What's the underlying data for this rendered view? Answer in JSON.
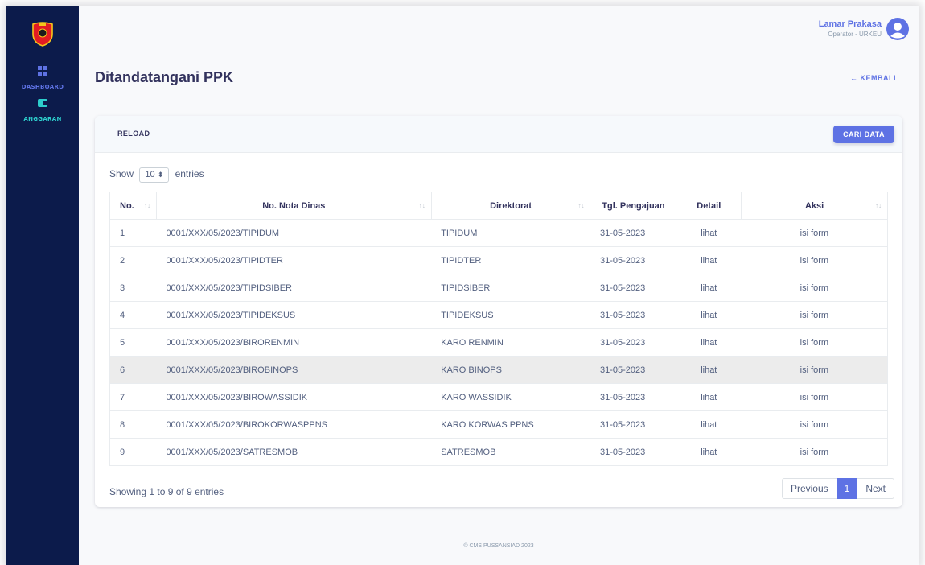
{
  "sidebar": {
    "items": [
      {
        "label": "DASHBOARD",
        "icon": "grid-icon",
        "color": "#5e72e4"
      },
      {
        "label": "ANGGARAN",
        "icon": "wallet-icon",
        "color": "#2dcecc"
      }
    ]
  },
  "user": {
    "name": "Lamar Prakasa",
    "role": "Operator - URKEU"
  },
  "page": {
    "title": "Ditandatangani PPK",
    "back_label": "← KEMBALI"
  },
  "card": {
    "reload_label": "RELOAD",
    "search_label": "CARI DATA"
  },
  "length_menu": {
    "prefix": "Show",
    "value": "10",
    "suffix": "entries"
  },
  "table": {
    "columns": [
      "No.",
      "No. Nota Dinas",
      "Direktorat",
      "Tgl. Pengajuan",
      "Detail",
      "Aksi"
    ],
    "rows": [
      {
        "no": "1",
        "nota": "0001/XXX/05/2023/TIPIDUM",
        "dir": "TIPIDUM",
        "tgl": "31-05-2023",
        "detail": "lihat",
        "aksi": "isi form"
      },
      {
        "no": "2",
        "nota": "0001/XXX/05/2023/TIPIDTER",
        "dir": "TIPIDTER",
        "tgl": "31-05-2023",
        "detail": "lihat",
        "aksi": "isi form"
      },
      {
        "no": "3",
        "nota": "0001/XXX/05/2023/TIPIDSIBER",
        "dir": "TIPIDSIBER",
        "tgl": "31-05-2023",
        "detail": "lihat",
        "aksi": "isi form"
      },
      {
        "no": "4",
        "nota": "0001/XXX/05/2023/TIPIDEKSUS",
        "dir": "TIPIDEKSUS",
        "tgl": "31-05-2023",
        "detail": "lihat",
        "aksi": "isi form"
      },
      {
        "no": "5",
        "nota": "0001/XXX/05/2023/BIRORENMIN",
        "dir": "KARO RENMIN",
        "tgl": "31-05-2023",
        "detail": "lihat",
        "aksi": "isi form"
      },
      {
        "no": "6",
        "nota": "0001/XXX/05/2023/BIROBINOPS",
        "dir": "KARO BINOPS",
        "tgl": "31-05-2023",
        "detail": "lihat",
        "aksi": "isi form"
      },
      {
        "no": "7",
        "nota": "0001/XXX/05/2023/BIROWASSIDIK",
        "dir": "KARO WASSIDIK",
        "tgl": "31-05-2023",
        "detail": "lihat",
        "aksi": "isi form"
      },
      {
        "no": "8",
        "nota": "0001/XXX/05/2023/BIROKORWASPPNS",
        "dir": "KARO KORWAS PPNS",
        "tgl": "31-05-2023",
        "detail": "lihat",
        "aksi": "isi form"
      },
      {
        "no": "9",
        "nota": "0001/XXX/05/2023/SATRESMOB",
        "dir": "SATRESMOB",
        "tgl": "31-05-2023",
        "detail": "lihat",
        "aksi": "isi form"
      }
    ]
  },
  "info": "Showing 1 to 9 of 9 entries",
  "pagination": {
    "previous": "Previous",
    "current": "1",
    "next": "Next"
  },
  "footer": "© CMS PUSSANSIAD 2023"
}
